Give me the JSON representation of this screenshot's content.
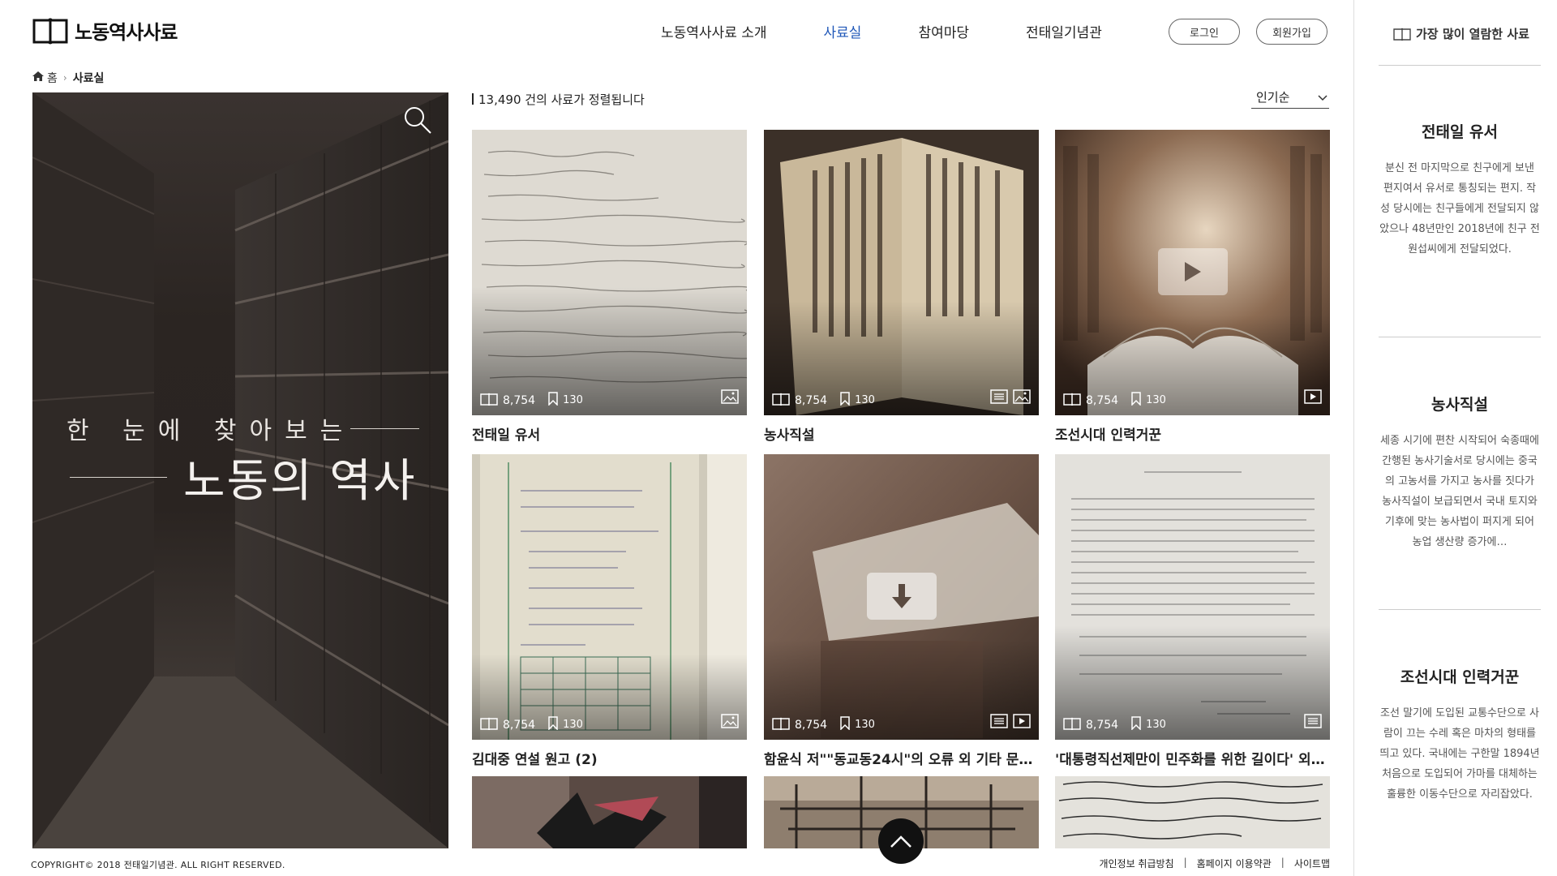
{
  "header": {
    "logo_text": "노동역사사료",
    "nav": [
      "노동역사사료 소개",
      "사료실",
      "참여마당",
      "전태일기념관"
    ],
    "active_nav": "사료실",
    "login_label": "로그인",
    "join_label": "회원가입"
  },
  "breadcrumb": {
    "home": "홈",
    "current": "사료실"
  },
  "hero": {
    "line1": "한 눈에 찾아보는",
    "line2": "노동의 역사"
  },
  "results": {
    "count_text": "13,490 건의 사료가 정렬됩니다",
    "sort_label": "인기순"
  },
  "cards": [
    {
      "title": "전태일 유서",
      "views": "8,754",
      "bookmarks": "130",
      "types": [
        "image-icon"
      ]
    },
    {
      "title": "농사직설",
      "views": "8,754",
      "bookmarks": "130",
      "types": [
        "document-icon",
        "image-icon"
      ]
    },
    {
      "title": "조선시대 인력거꾼",
      "views": "8,754",
      "bookmarks": "130",
      "types": [
        "video-icon"
      ]
    },
    {
      "title": "김대중 연설 원고 (2)",
      "views": "8,754",
      "bookmarks": "130",
      "types": [
        "image-icon"
      ]
    },
    {
      "title": "함윤식 저\"\"동교동24시\"의 오류 외 기타 문서…",
      "views": "8,754",
      "bookmarks": "130",
      "types": [
        "document-icon",
        "video-icon"
      ]
    },
    {
      "title": "'대통령직선제만이 민주화를 위한 길이다' 외…",
      "views": "8,754",
      "bookmarks": "130",
      "types": [
        "document-icon"
      ]
    }
  ],
  "sidebar": {
    "title": "가장 많이 열람한 사료",
    "items": [
      {
        "title": "전태일 유서",
        "desc": "분신 전 마지막으로 친구에게 보낸 편지여서 유서로 통칭되는 편지. 작성 당시에는 친구들에게 전달되지 않았으나 48년만인 2018년에 친구 전원섭씨에게 전달되었다."
      },
      {
        "title": "농사직설",
        "desc": "세종 시기에 편찬 시작되어 숙종때에 간행된 농사기술서로 당시에는 중국의 고농서를 가지고 농사를 짓다가 농사직설이 보급되면서 국내 토지와 기후에 맞는 농사법이 퍼지게 되어 농업 생산량 증가에…"
      },
      {
        "title": "조선시대 인력거꾼",
        "desc": "조선 말기에 도입된 교통수단으로 사람이 끄는 수레 혹은 마차의 형태를 띄고 있다. 국내에는 구한말 1894년 처음으로 도입되어 가마를 대체하는 훌륭한 이동수단으로 자리잡았다."
      }
    ]
  },
  "footer": {
    "copyright": "COPYRIGHT© 2018 전태일기념관. ALL RIGHT RESERVED.",
    "links": [
      "개인정보 취급방침",
      "홈페이지 이용약관",
      "사이트맵"
    ]
  },
  "colors": {
    "accent": "#1f57b8",
    "text": "#222222",
    "hero_bg": "#2b2522"
  }
}
